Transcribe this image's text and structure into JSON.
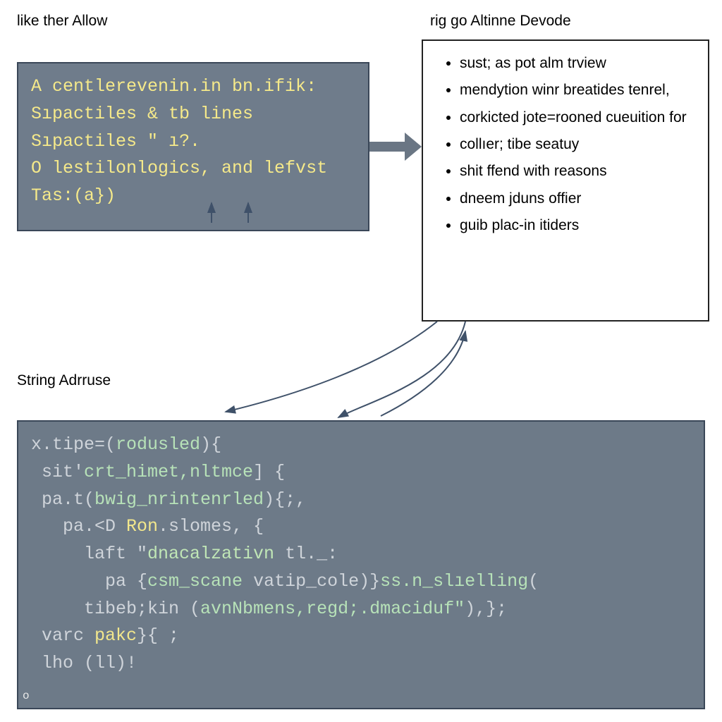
{
  "headers": {
    "left": "like ther Allow",
    "right": "rig go Altinne Devode",
    "mid": "String Adrruse"
  },
  "upper_box": {
    "lines": [
      "A centlerevenin.in bn.ifik:",
      "Sıpactiles & tb lines",
      "Sıpactiles \" ı?.",
      "O lestilonlogics, and lefvst",
      "Tas:(a})"
    ]
  },
  "right_box": {
    "items": [
      "sust; as pot alm trview",
      "mendytion winr breatides tenrel,",
      "corkicted jote=rooned cueuition for",
      "collıer; tibe seatuy",
      "shit ffend with reasons",
      "dneem jduns offier",
      "guib plac-in itiders"
    ]
  },
  "lower_box": {
    "l0": {
      "a": "x.tipe=(",
      "name": "rodusled",
      "b": "){"
    },
    "l1": {
      "a": " sit'",
      "name": "crt_himet,nltmce",
      "b": "] {"
    },
    "l2": {
      "a": " pa.t(",
      "name": "bwig_nrintenrled",
      "b": "){;,"
    },
    "l3": {
      "a": "   pa.<D ",
      "kw": "Ron",
      "b": ".slomes, {"
    },
    "l4": {
      "a": "     laft \"",
      "str": "dnacalzativn",
      "b": " tl._:"
    },
    "l5": {
      "a": "       pa {",
      "name1": "csm_scane",
      "mid": " vatip_cole)}",
      "name2": "ss.n_slıelling",
      "b": "("
    },
    "l6": {
      "a": "     tibeb;kin (",
      "args": "avnNbmens,regd;.dmaciduf\"",
      "b": "),};"
    },
    "l7": {
      "a": " varc ",
      "kw": "pakc",
      "b": "}{ ;"
    },
    "l8": {
      "a": " lho (ll)!"
    },
    "caret": "o"
  }
}
